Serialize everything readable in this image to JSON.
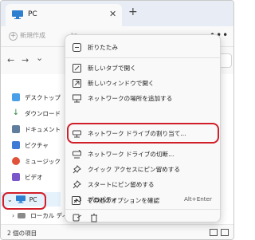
{
  "window": {
    "tab_title": "PC",
    "tab_close": "✕",
    "tab_add": "+"
  },
  "command_bar": {
    "new_label": "新規作成",
    "more_label": "•••"
  },
  "address_bar": {
    "back": "←",
    "forward": "→",
    "dropdown": "⌄"
  },
  "sidebar": {
    "items": [
      {
        "label": "デスクトップ",
        "color": "#4aa0e8"
      },
      {
        "label": "ダウンロード",
        "color": "#2b8a3e"
      },
      {
        "label": "ドキュメント",
        "color": "#607d9e"
      },
      {
        "label": "ピクチャ",
        "color": "#3e7bd6"
      },
      {
        "label": "ミュージック",
        "color": "#e0533a"
      },
      {
        "label": "ビデオ",
        "color": "#7a58c9"
      }
    ],
    "pc_label": "PC",
    "local_disk_label": "ローカル ディス"
  },
  "status_bar": {
    "count": "2 個の項目"
  },
  "context_menu": {
    "items": [
      {
        "label": "折りたたみ",
        "icon": "collapse-icon"
      },
      {
        "label": "新しいタブで開く",
        "icon": "new-tab-icon"
      },
      {
        "label": "新しいウィンドウで開く",
        "icon": "new-window-icon"
      },
      {
        "label": "ネットワークの場所を追加する",
        "icon": "add-network-location-icon"
      },
      {
        "label": "ネットワーク ドライブの割り当て...",
        "icon": "map-network-drive-icon"
      },
      {
        "label": "ネットワーク ドライブの切断...",
        "icon": "disconnect-network-drive-icon"
      },
      {
        "label": "クイック アクセスにピン留めする",
        "icon": "pin-icon"
      },
      {
        "label": "スタートにピン留めする",
        "icon": "pin-start-icon"
      },
      {
        "label": "プロパティ",
        "icon": "wrench-icon",
        "shortcut": "Alt+Enter"
      },
      {
        "label": "その他のオプションを確認",
        "icon": "more-options-icon"
      }
    ]
  },
  "colors": {
    "highlight": "#d11f2a",
    "accent": "#0067c0"
  }
}
